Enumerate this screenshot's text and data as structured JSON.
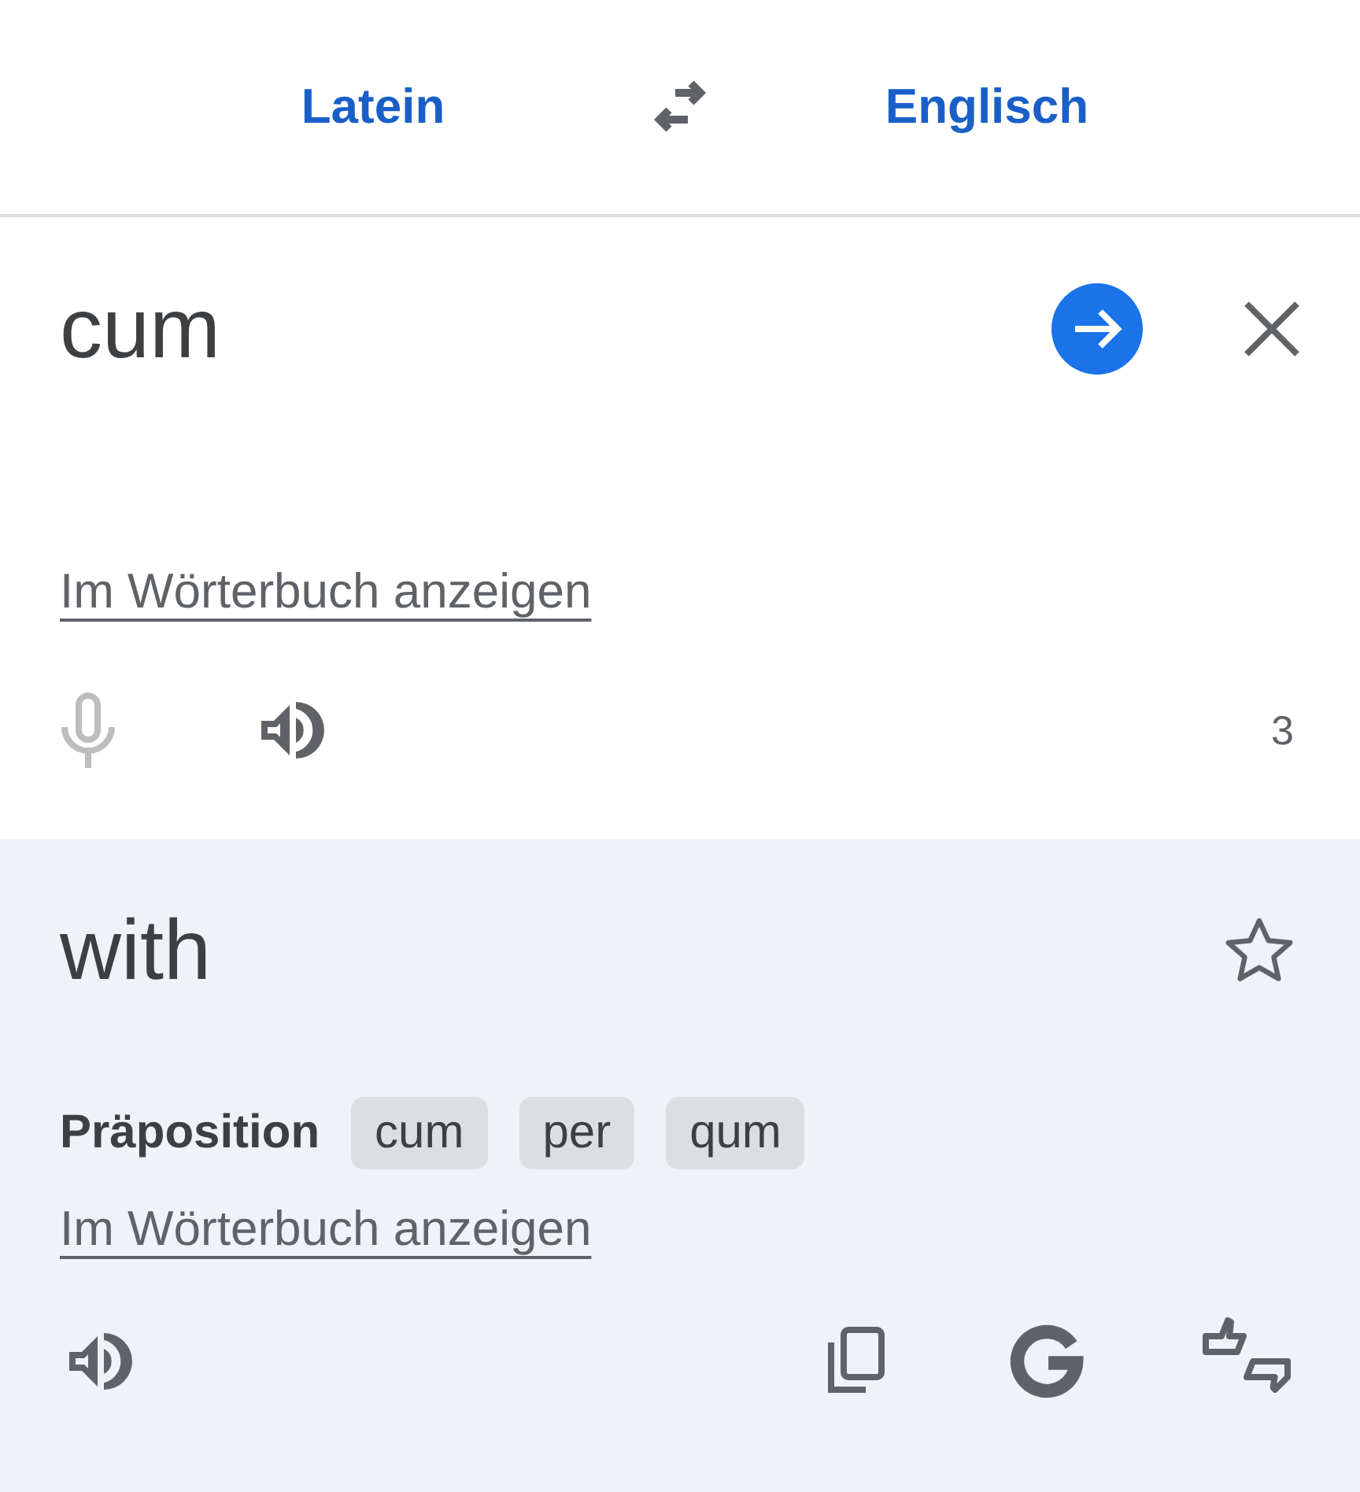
{
  "languages": {
    "source": "Latein",
    "target": "Englisch"
  },
  "input": {
    "value": "cum",
    "dictionary_link": "Im Wörterbuch anzeigen",
    "mic_disabled": true,
    "char_count": "3"
  },
  "output": {
    "translation": "with",
    "starred": false,
    "part_of_speech": "Präposition",
    "chips": [
      "cum",
      "per",
      "qum"
    ],
    "dictionary_link": "Im Wörterbuch anzeigen"
  }
}
